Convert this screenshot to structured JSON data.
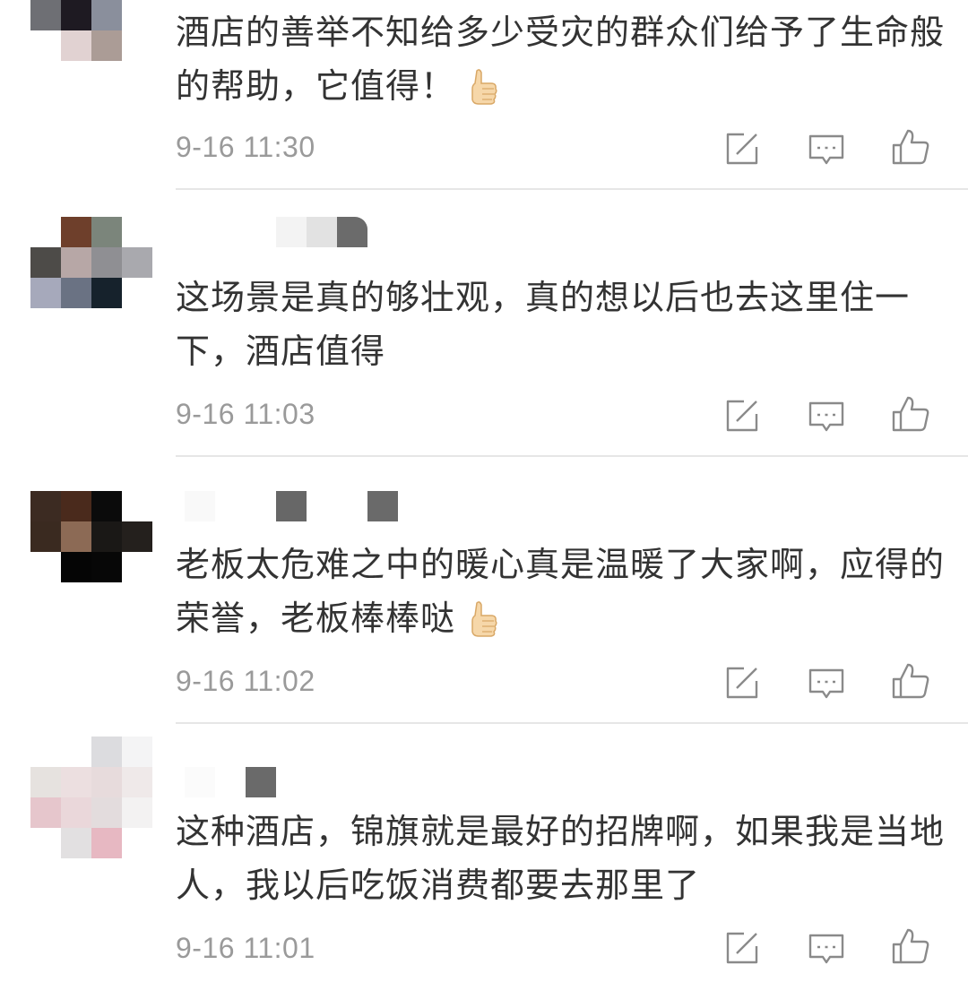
{
  "comments": [
    {
      "text": "酒店的善举不知给多少受灾的群众们给予了生命般的帮助，它值得！",
      "emoji": "thumbs-up",
      "time": "9-16 11:30"
    },
    {
      "text": "这场景是真的够壮观，真的想以后也去这里住一下，酒店值得",
      "emoji": "",
      "time": "9-16 11:03"
    },
    {
      "text": "老板太危难之中的暖心真是温暖了大家啊，应得的荣誉，老板棒棒哒",
      "emoji": "thumbs-up",
      "time": "9-16 11:02"
    },
    {
      "text": "这种酒店，锦旗就是最好的招牌啊，如果我是当地人，我以后吃饭消费都要去那里了",
      "emoji": "",
      "time": "9-16 11:01"
    }
  ],
  "icons": {
    "share": "share-icon",
    "reply": "comment-icon",
    "like": "like-icon",
    "emoji": "thumbs-up-emoji-icon"
  },
  "colors": {
    "text": "#333333",
    "time": "#9a9a9a",
    "icon": "#8a8a8a",
    "divider": "#e6e6e6"
  }
}
